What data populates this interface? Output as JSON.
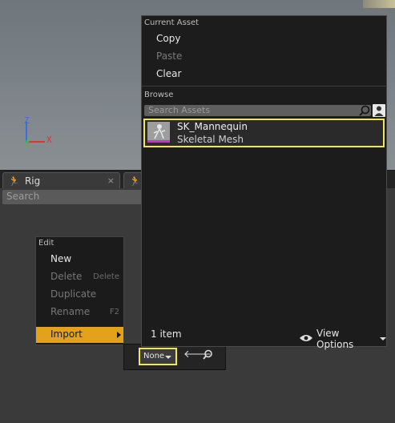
{
  "viewport": {
    "axes": {
      "z": "Z",
      "y": "Y",
      "x": "X"
    }
  },
  "tabs": [
    {
      "label": "Rig",
      "icon": "running-figure-icon",
      "close": "×"
    },
    {
      "label": "",
      "icon": "running-figure-icon"
    }
  ],
  "tree_search": {
    "placeholder": "Search"
  },
  "context_menu": {
    "header": "Edit",
    "items": [
      {
        "label": "New",
        "shortcut": "",
        "enabled": true
      },
      {
        "label": "Delete",
        "shortcut": "Delete",
        "enabled": false
      },
      {
        "label": "Duplicate",
        "shortcut": "",
        "enabled": false
      },
      {
        "label": "Rename",
        "shortcut": "F2",
        "enabled": false
      },
      {
        "label": "Import",
        "shortcut": "",
        "enabled": true,
        "highlighted": true
      }
    ]
  },
  "toolstrip": {
    "value_label": "None"
  },
  "asset_picker": {
    "current_asset_header": "Current Asset",
    "actions": [
      {
        "label": "Copy",
        "enabled": true
      },
      {
        "label": "Paste",
        "enabled": false
      },
      {
        "label": "Clear",
        "enabled": true
      }
    ],
    "browse_header": "Browse",
    "search_placeholder": "Search Assets",
    "assets": [
      {
        "name": "SK_Mannequin",
        "type": "Skeletal Mesh"
      }
    ],
    "item_count": "1 item",
    "view_options_label": "View Options"
  },
  "colors": {
    "accent_orange": "#e3a21a",
    "focus_yellow": "#f2e45c",
    "skeletal_mesh_magenta": "#d12fc8",
    "axis_z": "#3b6fe0",
    "axis_y": "#3fc43f",
    "axis_x": "#e03434"
  }
}
